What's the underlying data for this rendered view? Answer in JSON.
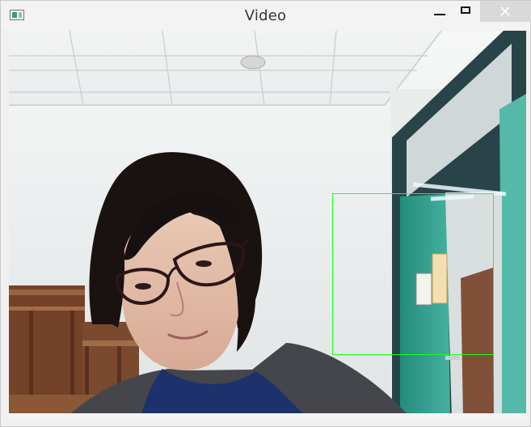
{
  "window": {
    "title": "Video",
    "controls": {
      "minimize": "minimize",
      "maximize": "maximize",
      "close": "close"
    }
  },
  "video": {
    "face_box_color": "#1cff1c"
  },
  "icons": {
    "app": "app-icon",
    "minimize": "minimize-icon",
    "maximize": "maximize-icon",
    "close": "close-icon"
  }
}
